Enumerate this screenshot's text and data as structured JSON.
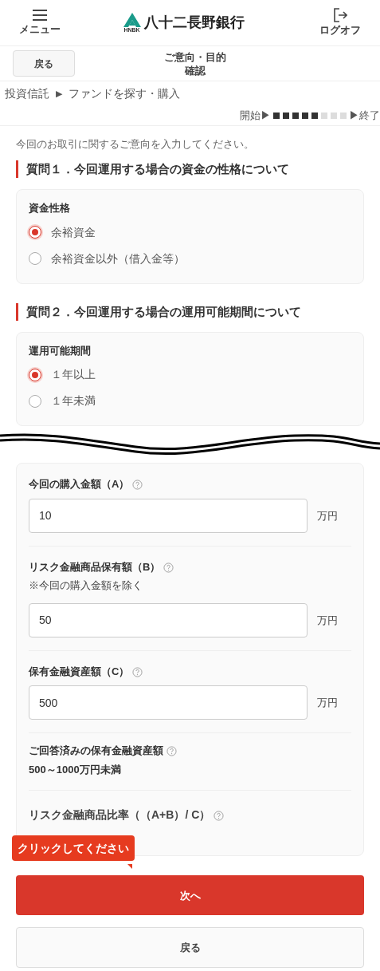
{
  "header": {
    "menu_label": "メニュー",
    "bank_name": "八十二長野銀行",
    "logo_mark": "HNBK",
    "logout_label": "ログオフ"
  },
  "subheader": {
    "back_button": "戻る",
    "title_lines": [
      "ご意向・目的",
      "確認"
    ]
  },
  "breadcrumb": [
    "投資信託",
    "ファンドを探す・購入"
  ],
  "breadcrumb_separator": "▶",
  "progress": {
    "start": "開始▶",
    "end": "▶終了",
    "steps": [
      {
        "done": true
      },
      {
        "done": true
      },
      {
        "done": true
      },
      {
        "done": true
      },
      {
        "done": true
      },
      {
        "done": false
      },
      {
        "done": false
      },
      {
        "done": false
      }
    ]
  },
  "intro": "今回のお取引に関するご意向を入力してください。",
  "questions": [
    {
      "heading": "質問１．今回運用する場合の資金の性格について",
      "label": "資金性格",
      "options": [
        {
          "label": "余裕資金",
          "selected": true
        },
        {
          "label": "余裕資金以外（借入金等）",
          "selected": false
        }
      ]
    },
    {
      "heading": "質問２．今回運用する場合の運用可能期間について",
      "label": "運用可能期間",
      "options": [
        {
          "label": "１年以上",
          "selected": true
        },
        {
          "label": "１年未満",
          "selected": false
        }
      ]
    }
  ],
  "amount_fields": [
    {
      "kind": "input",
      "label": "今回の購入金額（A）",
      "help": true,
      "value": "10",
      "unit": "万円"
    },
    {
      "kind": "input",
      "label": "リスク金融商品保有額（B）",
      "help": true,
      "note": "※今回の購入金額を除く",
      "value": "50",
      "unit": "万円"
    },
    {
      "kind": "input",
      "label": "保有金融資産額（C）",
      "help": true,
      "value": "500",
      "unit": "万円"
    },
    {
      "kind": "info",
      "label": "ご回答済みの保有金融資産額",
      "help": true,
      "value": "500～1000万円未満"
    },
    {
      "kind": "ratio",
      "label": "リスク金融商品比率（（A+B）/ C）",
      "help": true
    }
  ],
  "tooltip": "クリックしてください",
  "next_button": "次へ",
  "back_button": "戻る"
}
